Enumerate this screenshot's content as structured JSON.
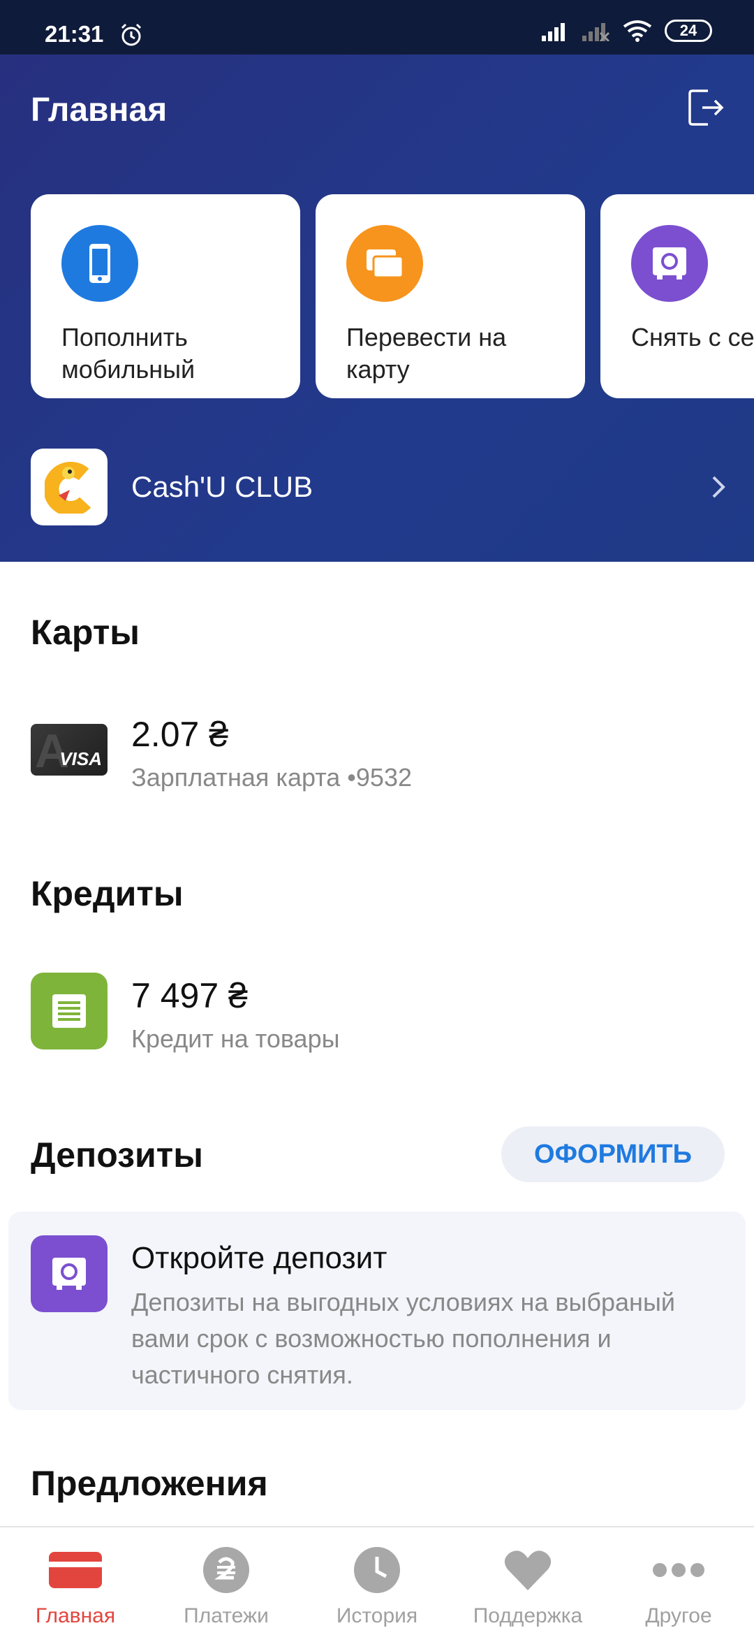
{
  "status_bar": {
    "time": "21:31",
    "battery": "24"
  },
  "header": {
    "title": "Главная"
  },
  "quick_actions": [
    {
      "label": "Пополнить\nмобильный",
      "icon": "phone-icon",
      "color": "#1f7ae0"
    },
    {
      "label": "Перевести на\nкарту",
      "icon": "transfer-card-icon",
      "color": "#f7941d"
    },
    {
      "label": "Снять с сей",
      "icon": "safe-icon",
      "color": "#7b4fd0"
    }
  ],
  "club": {
    "label": "Cash'U CLUB"
  },
  "cards_section": {
    "title": "Карты",
    "card": {
      "amount": "2.07 ₴",
      "description": "Зарплатная карта  •9532",
      "brand": "VISA"
    }
  },
  "credits_section": {
    "title": "Кредиты",
    "credit": {
      "amount": "7 497 ₴",
      "description": "Кредит на товары",
      "color": "#7fb43a"
    }
  },
  "deposits_section": {
    "title": "Депозиты",
    "button_label": "ОФОРМИТЬ",
    "promo_title": "Откройте депозит",
    "promo_text": "Депозиты на выгодных условиях на выбраный вами срок с возможностью пополнения и частичного снятия."
  },
  "offers_section": {
    "title": "Предложения"
  },
  "bottom_nav": [
    {
      "label": "Главная",
      "icon": "home-card-icon",
      "active": true
    },
    {
      "label": "Платежи",
      "icon": "hryvnia-icon",
      "active": false
    },
    {
      "label": "История",
      "icon": "clock-icon",
      "active": false
    },
    {
      "label": "Поддержка",
      "icon": "heart-icon",
      "active": false
    },
    {
      "label": "Другое",
      "icon": "more-dots-icon",
      "active": false
    }
  ],
  "colors": {
    "hero_bg": "#233a8a",
    "accent_blue": "#1f7ae0",
    "active_red": "#e2453e"
  }
}
